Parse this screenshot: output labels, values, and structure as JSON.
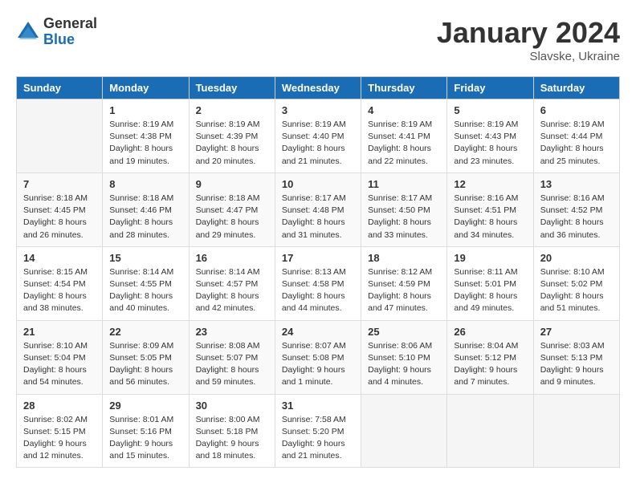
{
  "logo": {
    "general": "General",
    "blue": "Blue"
  },
  "title": "January 2024",
  "subtitle": "Slavske, Ukraine",
  "days_header": [
    "Sunday",
    "Monday",
    "Tuesday",
    "Wednesday",
    "Thursday",
    "Friday",
    "Saturday"
  ],
  "weeks": [
    [
      {
        "day": "",
        "sunrise": "",
        "sunset": "",
        "daylight": ""
      },
      {
        "day": "1",
        "sunrise": "Sunrise: 8:19 AM",
        "sunset": "Sunset: 4:38 PM",
        "daylight": "Daylight: 8 hours and 19 minutes."
      },
      {
        "day": "2",
        "sunrise": "Sunrise: 8:19 AM",
        "sunset": "Sunset: 4:39 PM",
        "daylight": "Daylight: 8 hours and 20 minutes."
      },
      {
        "day": "3",
        "sunrise": "Sunrise: 8:19 AM",
        "sunset": "Sunset: 4:40 PM",
        "daylight": "Daylight: 8 hours and 21 minutes."
      },
      {
        "day": "4",
        "sunrise": "Sunrise: 8:19 AM",
        "sunset": "Sunset: 4:41 PM",
        "daylight": "Daylight: 8 hours and 22 minutes."
      },
      {
        "day": "5",
        "sunrise": "Sunrise: 8:19 AM",
        "sunset": "Sunset: 4:43 PM",
        "daylight": "Daylight: 8 hours and 23 minutes."
      },
      {
        "day": "6",
        "sunrise": "Sunrise: 8:19 AM",
        "sunset": "Sunset: 4:44 PM",
        "daylight": "Daylight: 8 hours and 25 minutes."
      }
    ],
    [
      {
        "day": "7",
        "sunrise": "Sunrise: 8:18 AM",
        "sunset": "Sunset: 4:45 PM",
        "daylight": "Daylight: 8 hours and 26 minutes."
      },
      {
        "day": "8",
        "sunrise": "Sunrise: 8:18 AM",
        "sunset": "Sunset: 4:46 PM",
        "daylight": "Daylight: 8 hours and 28 minutes."
      },
      {
        "day": "9",
        "sunrise": "Sunrise: 8:18 AM",
        "sunset": "Sunset: 4:47 PM",
        "daylight": "Daylight: 8 hours and 29 minutes."
      },
      {
        "day": "10",
        "sunrise": "Sunrise: 8:17 AM",
        "sunset": "Sunset: 4:48 PM",
        "daylight": "Daylight: 8 hours and 31 minutes."
      },
      {
        "day": "11",
        "sunrise": "Sunrise: 8:17 AM",
        "sunset": "Sunset: 4:50 PM",
        "daylight": "Daylight: 8 hours and 33 minutes."
      },
      {
        "day": "12",
        "sunrise": "Sunrise: 8:16 AM",
        "sunset": "Sunset: 4:51 PM",
        "daylight": "Daylight: 8 hours and 34 minutes."
      },
      {
        "day": "13",
        "sunrise": "Sunrise: 8:16 AM",
        "sunset": "Sunset: 4:52 PM",
        "daylight": "Daylight: 8 hours and 36 minutes."
      }
    ],
    [
      {
        "day": "14",
        "sunrise": "Sunrise: 8:15 AM",
        "sunset": "Sunset: 4:54 PM",
        "daylight": "Daylight: 8 hours and 38 minutes."
      },
      {
        "day": "15",
        "sunrise": "Sunrise: 8:14 AM",
        "sunset": "Sunset: 4:55 PM",
        "daylight": "Daylight: 8 hours and 40 minutes."
      },
      {
        "day": "16",
        "sunrise": "Sunrise: 8:14 AM",
        "sunset": "Sunset: 4:57 PM",
        "daylight": "Daylight: 8 hours and 42 minutes."
      },
      {
        "day": "17",
        "sunrise": "Sunrise: 8:13 AM",
        "sunset": "Sunset: 4:58 PM",
        "daylight": "Daylight: 8 hours and 44 minutes."
      },
      {
        "day": "18",
        "sunrise": "Sunrise: 8:12 AM",
        "sunset": "Sunset: 4:59 PM",
        "daylight": "Daylight: 8 hours and 47 minutes."
      },
      {
        "day": "19",
        "sunrise": "Sunrise: 8:11 AM",
        "sunset": "Sunset: 5:01 PM",
        "daylight": "Daylight: 8 hours and 49 minutes."
      },
      {
        "day": "20",
        "sunrise": "Sunrise: 8:10 AM",
        "sunset": "Sunset: 5:02 PM",
        "daylight": "Daylight: 8 hours and 51 minutes."
      }
    ],
    [
      {
        "day": "21",
        "sunrise": "Sunrise: 8:10 AM",
        "sunset": "Sunset: 5:04 PM",
        "daylight": "Daylight: 8 hours and 54 minutes."
      },
      {
        "day": "22",
        "sunrise": "Sunrise: 8:09 AM",
        "sunset": "Sunset: 5:05 PM",
        "daylight": "Daylight: 8 hours and 56 minutes."
      },
      {
        "day": "23",
        "sunrise": "Sunrise: 8:08 AM",
        "sunset": "Sunset: 5:07 PM",
        "daylight": "Daylight: 8 hours and 59 minutes."
      },
      {
        "day": "24",
        "sunrise": "Sunrise: 8:07 AM",
        "sunset": "Sunset: 5:08 PM",
        "daylight": "Daylight: 9 hours and 1 minute."
      },
      {
        "day": "25",
        "sunrise": "Sunrise: 8:06 AM",
        "sunset": "Sunset: 5:10 PM",
        "daylight": "Daylight: 9 hours and 4 minutes."
      },
      {
        "day": "26",
        "sunrise": "Sunrise: 8:04 AM",
        "sunset": "Sunset: 5:12 PM",
        "daylight": "Daylight: 9 hours and 7 minutes."
      },
      {
        "day": "27",
        "sunrise": "Sunrise: 8:03 AM",
        "sunset": "Sunset: 5:13 PM",
        "daylight": "Daylight: 9 hours and 9 minutes."
      }
    ],
    [
      {
        "day": "28",
        "sunrise": "Sunrise: 8:02 AM",
        "sunset": "Sunset: 5:15 PM",
        "daylight": "Daylight: 9 hours and 12 minutes."
      },
      {
        "day": "29",
        "sunrise": "Sunrise: 8:01 AM",
        "sunset": "Sunset: 5:16 PM",
        "daylight": "Daylight: 9 hours and 15 minutes."
      },
      {
        "day": "30",
        "sunrise": "Sunrise: 8:00 AM",
        "sunset": "Sunset: 5:18 PM",
        "daylight": "Daylight: 9 hours and 18 minutes."
      },
      {
        "day": "31",
        "sunrise": "Sunrise: 7:58 AM",
        "sunset": "Sunset: 5:20 PM",
        "daylight": "Daylight: 9 hours and 21 minutes."
      },
      {
        "day": "",
        "sunrise": "",
        "sunset": "",
        "daylight": ""
      },
      {
        "day": "",
        "sunrise": "",
        "sunset": "",
        "daylight": ""
      },
      {
        "day": "",
        "sunrise": "",
        "sunset": "",
        "daylight": ""
      }
    ]
  ]
}
